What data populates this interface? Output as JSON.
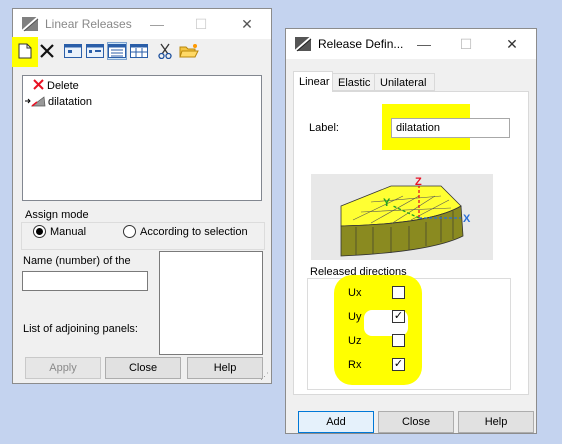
{
  "win1": {
    "title": "Linear Releases",
    "toolbar_icons": [
      "new-document-icon",
      "delete-x-icon",
      "view-icon",
      "view-alt-icon",
      "grid-view-icon",
      "table-view-icon",
      "cut-icon",
      "open-folder-icon"
    ],
    "list": {
      "items": [
        {
          "label": "Delete",
          "icon": "red-x-icon"
        },
        {
          "label": "dilatation",
          "icon": "release-icon"
        }
      ]
    },
    "assign_mode": {
      "label": "Assign mode",
      "options": [
        "Manual",
        "According to selection"
      ],
      "selected": "Manual"
    },
    "name_label": "Name (number) of the",
    "adjoining_label": "List of adjoining panels:",
    "buttons": {
      "apply": "Apply",
      "close": "Close",
      "help": "Help"
    }
  },
  "win2": {
    "title": "Release Defin...",
    "tabs": [
      "Linear",
      "Elastic",
      "Unilateral"
    ],
    "active_tab": "Linear",
    "label_caption": "Label:",
    "label_value": "dilatation",
    "axis_labels": {
      "z": "Z",
      "y": "Y",
      "x": "X"
    },
    "released_group": "Released directions",
    "directions": [
      {
        "label": "Ux",
        "checked": false
      },
      {
        "label": "Uy",
        "checked": true
      },
      {
        "label": "Uz",
        "checked": false
      },
      {
        "label": "Rx",
        "checked": true
      }
    ],
    "buttons": {
      "add": "Add",
      "close": "Close",
      "help": "Help"
    }
  },
  "colors": {
    "highlight": "#ffff00",
    "selection_blue": "#0078d7",
    "red": "#e81123"
  }
}
